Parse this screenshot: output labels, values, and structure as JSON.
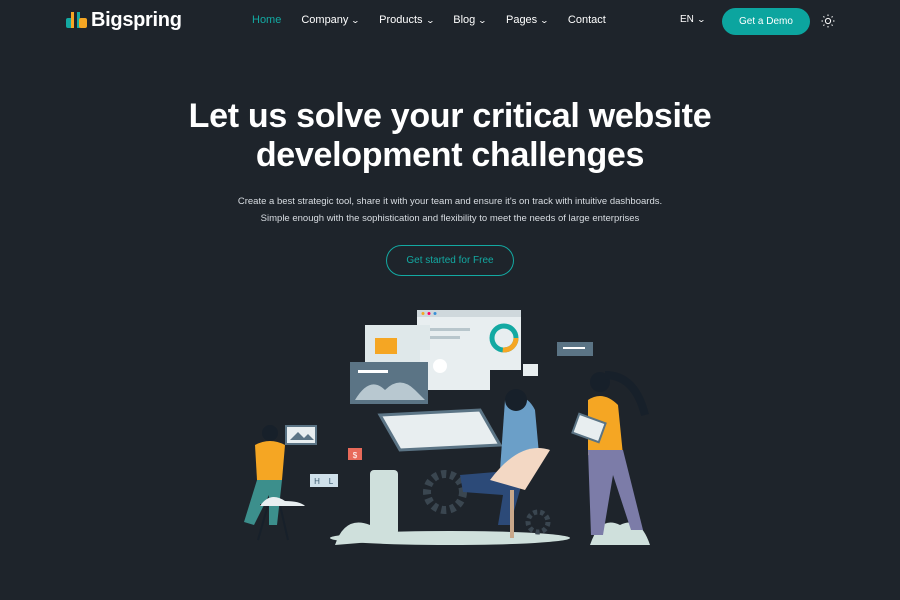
{
  "brand": {
    "name": "Bigspring",
    "colors": {
      "accent": "#0ca59f",
      "logo_orange": "#f5a623",
      "background": "#1e242b"
    }
  },
  "nav": {
    "items": [
      {
        "label": "Home",
        "active": true,
        "dropdown": false
      },
      {
        "label": "Company",
        "dropdown": true
      },
      {
        "label": "Products",
        "dropdown": true
      },
      {
        "label": "Blog",
        "dropdown": true
      },
      {
        "label": "Pages",
        "dropdown": true
      },
      {
        "label": "Contact",
        "dropdown": false
      }
    ],
    "language": "EN",
    "demo_button": "Get a Demo",
    "theme_icon": "sun-icon"
  },
  "hero": {
    "title_line1": "Let us solve your critical website",
    "title_line2": "development challenges",
    "subtitle_line1": "Create a best strategic tool, share it with your team and ensure it's on track with intuitive dashboards.",
    "subtitle_line2": "Simple enough with the sophistication and flexibility to meet the needs of large enterprises",
    "cta": "Get started for Free"
  },
  "illustration": {
    "labels": [
      "$",
      "H",
      "L"
    ]
  }
}
